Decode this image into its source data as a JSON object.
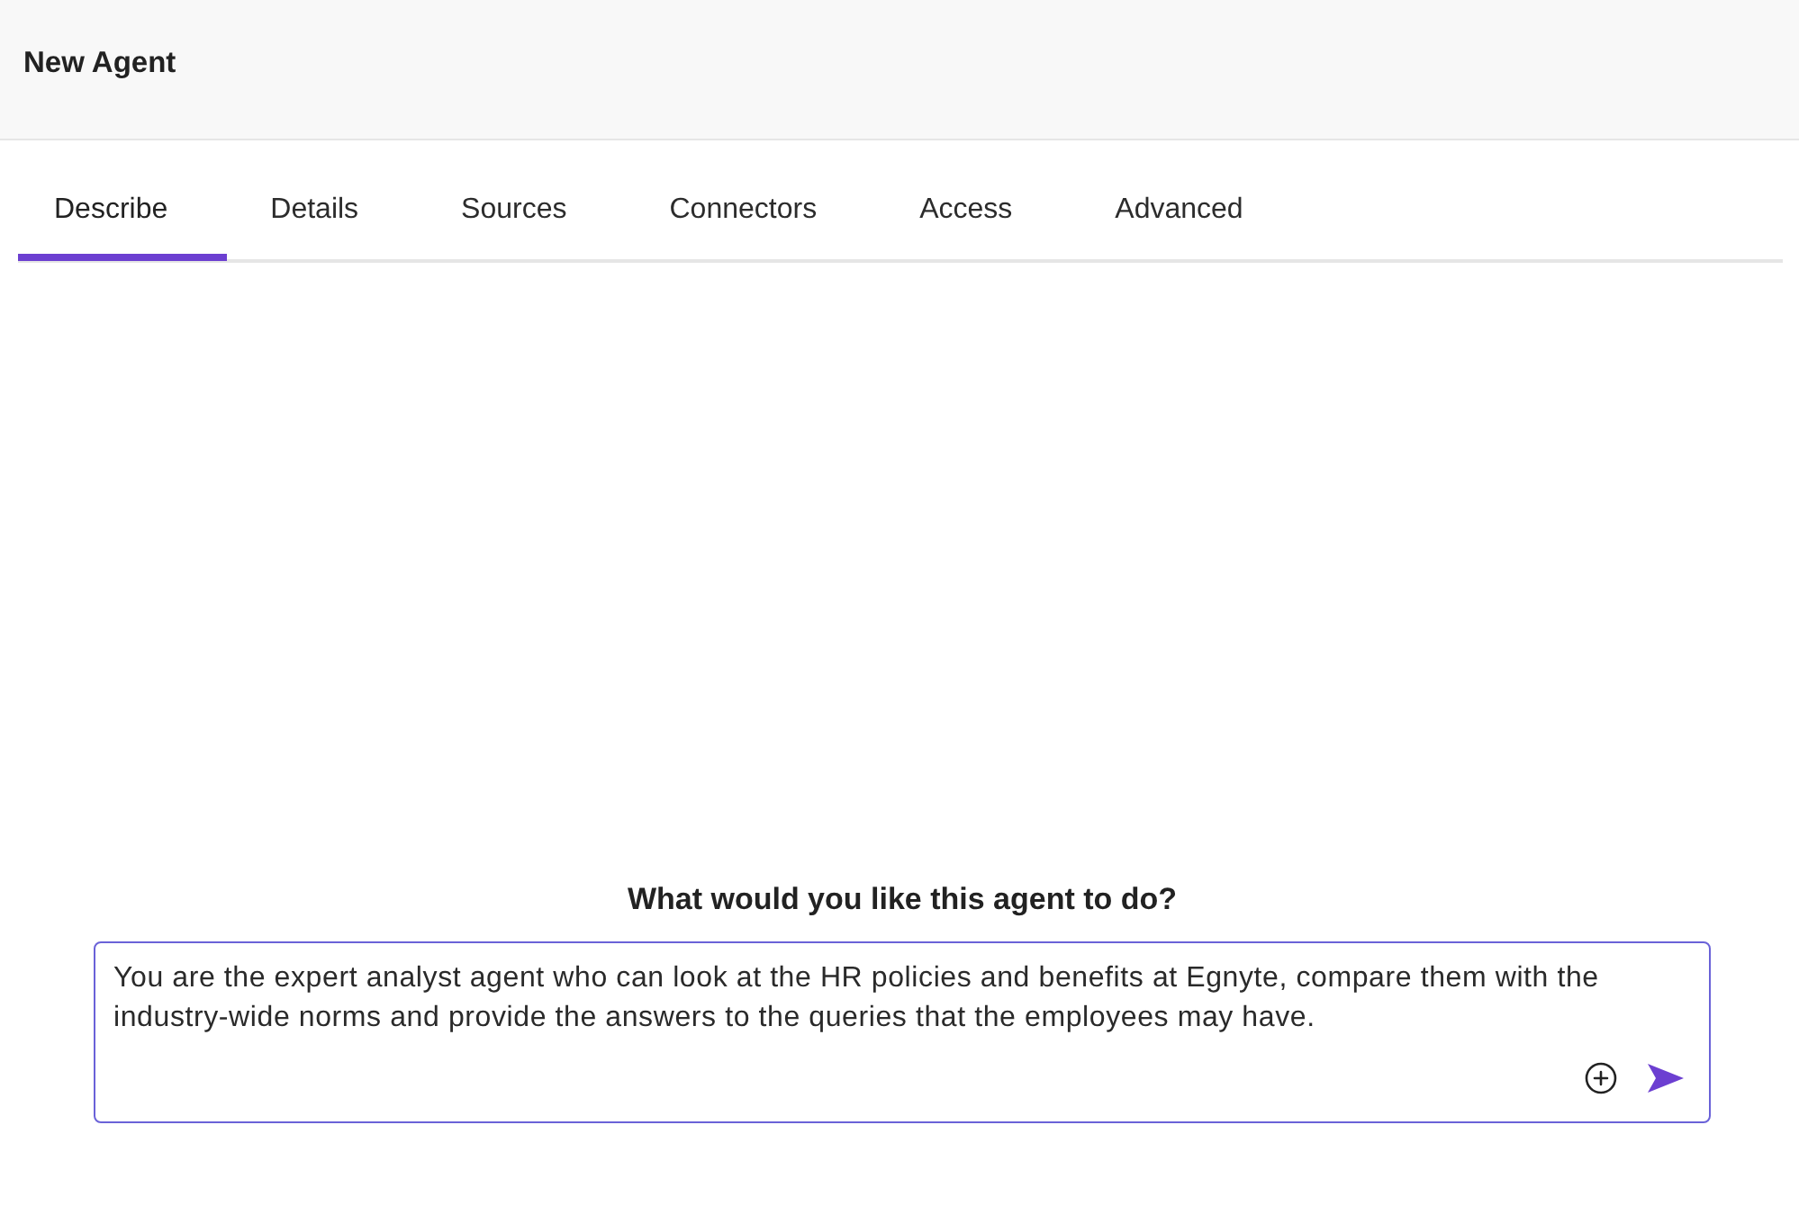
{
  "header": {
    "title": "New Agent"
  },
  "tabs": [
    {
      "label": "Describe",
      "selected": true
    },
    {
      "label": "Details",
      "selected": false
    },
    {
      "label": "Sources",
      "selected": false
    },
    {
      "label": "Connectors",
      "selected": false
    },
    {
      "label": "Access",
      "selected": false
    },
    {
      "label": "Advanced",
      "selected": false
    }
  ],
  "prompt": {
    "question": "What would you like this agent to do?",
    "value": "You are the expert analyst agent who can look at the HR policies and benefits at Egnyte, compare them with the industry-wide norms and provide the answers to the queries that the employees may have."
  }
}
